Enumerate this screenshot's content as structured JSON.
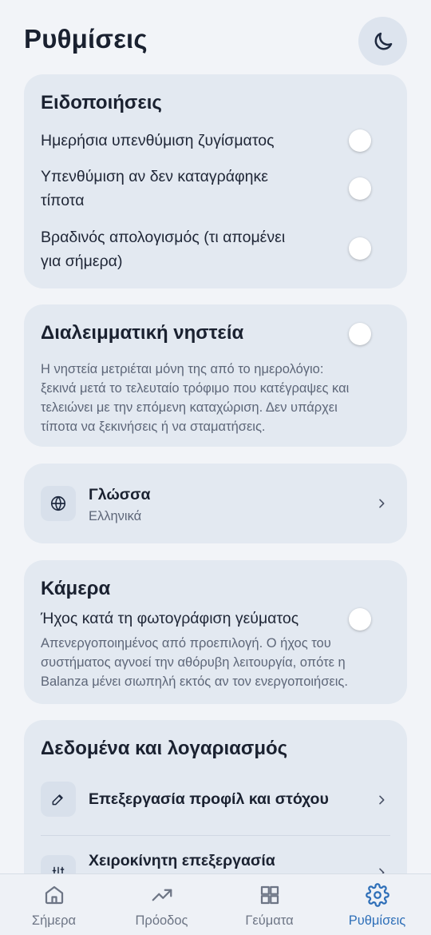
{
  "header": {
    "title": "Ρυθμίσεις",
    "theme_icon": "moon-icon"
  },
  "notifications": {
    "title": "Ειδοποιήσεις",
    "rows": [
      {
        "label": "Ημερήσια υπενθύμιση ζυγίσματος",
        "on": false
      },
      {
        "label_line1": "Υπενθύμιση αν δεν καταγράφηκε",
        "label_line2": "τίποτα",
        "on": false
      },
      {
        "label_line1": "Βραδινός απολογισμός (τι απομένει",
        "label_line2": "για σήμερα)",
        "on": false
      }
    ]
  },
  "fasting": {
    "title": "Διαλειμματική νηστεία",
    "on": false,
    "desc_lines": [
      "Η νηστεία μετριέται μόνη της από το ημερολόγιο:",
      "ξεκινά μετά το τελευταίο τρόφιμο που κατέγραψες και",
      "τελειώνει με την επόμενη καταχώριση. Δεν υπάρχει",
      "τίποτα να ξεκινήσεις ή να σταματήσεις."
    ]
  },
  "language": {
    "title": "Γλώσσα",
    "value": "Ελληνικά",
    "icon": "globe-icon"
  },
  "camera": {
    "title": "Κάμερα",
    "row_label": "Ήχος κατά τη φωτογράφιση γεύματος",
    "on": false,
    "desc_lines": [
      "Απενεργοποιημένος από προεπιλογή. Ο ήχος του",
      "συστήματος αγνοεί την αθόρυβη λειτουργία, οπότε η",
      "Balanza μένει σιωπηλή εκτός αν τον ενεργοποιήσεις."
    ]
  },
  "data_account": {
    "title": "Δεδομένα και λογαριασμός",
    "items": [
      {
        "label": "Επεξεργασία προφίλ και στόχου",
        "icon": "pencil-icon"
      },
      {
        "label": "Χειροκίνητη επεξεργασία",
        "icon": "sliders-icon"
      }
    ]
  },
  "nav": {
    "items": [
      {
        "label": "Σήμερα",
        "icon": "home-icon"
      },
      {
        "label": "Πρόοδος",
        "icon": "trend-icon"
      },
      {
        "label": "Γεύματα",
        "icon": "grid-icon"
      },
      {
        "label": "Ρυθμίσεις",
        "icon": "gear-icon",
        "active": true
      }
    ]
  },
  "colors": {
    "accent": "#2e6fb8",
    "card": "#e3e9f1",
    "background": "#f2f4f8"
  }
}
